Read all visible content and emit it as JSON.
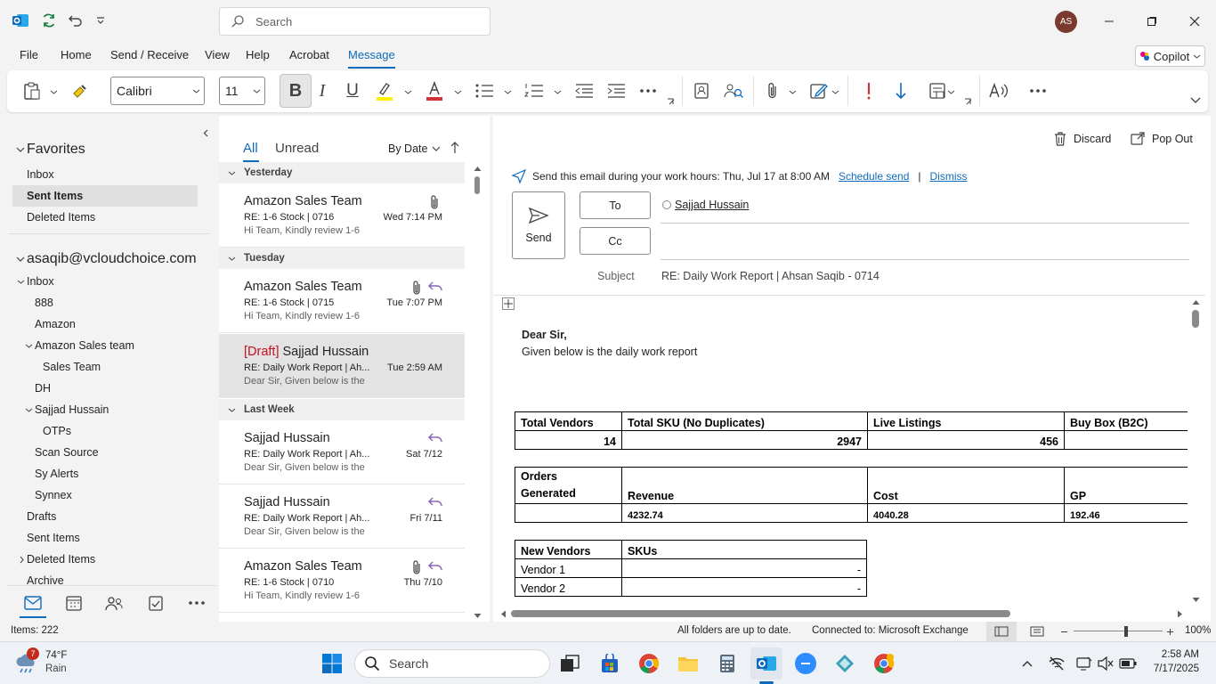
{
  "titlebar": {
    "search_placeholder": "Search",
    "avatar_initials": "AS"
  },
  "menu": [
    "File",
    "Home",
    "Send / Receive",
    "View",
    "Help",
    "Acrobat",
    "Message"
  ],
  "copilot_label": "Copilot",
  "ribbon": {
    "font_name": "Calibri",
    "font_size": "11",
    "bold": "B",
    "italic": "I",
    "underline": "U"
  },
  "nav": {
    "favorites": "Favorites",
    "fav_items": [
      "Inbox",
      "Sent Items",
      "Deleted Items"
    ],
    "account": "asaqib@vcloudchoice.com",
    "inbox": "Inbox",
    "folders": [
      "888",
      "Amazon",
      "Amazon Sales team",
      "Sales Team",
      "DH",
      "Sajjad Hussain",
      "OTPs",
      "Scan Source",
      "Sy Alerts",
      "Synnex",
      "Drafts",
      "Sent Items",
      "Deleted Items",
      "Archive"
    ]
  },
  "list": {
    "tab_all": "All",
    "tab_unread": "Unread",
    "sort": "By Date",
    "groups": [
      "Yesterday",
      "Tuesday",
      "Last Week"
    ],
    "items": [
      {
        "from": "Amazon Sales Team",
        "draft": "",
        "subject": "RE: 1-6 Stock | 0716",
        "preview": "Hi Team,  Kindly review 1-6",
        "time": "Wed 7:14 PM"
      },
      {
        "from": "Amazon Sales Team",
        "draft": "",
        "subject": "RE: 1-6 Stock | 0715",
        "preview": "Hi Team,  Kindly review 1-6",
        "time": "Tue 7:07 PM"
      },
      {
        "from": " Sajjad Hussain",
        "draft": "[Draft]",
        "subject": "RE: Daily Work Report | Ah...",
        "preview": "Dear Sir,  Given below is the",
        "time": "Tue 2:59 AM"
      },
      {
        "from": "Sajjad Hussain",
        "draft": "",
        "subject": "RE: Daily Work Report | Ah...",
        "preview": "Dear Sir,  Given below is the",
        "time": "Sat 7/12"
      },
      {
        "from": "Sajjad Hussain",
        "draft": "",
        "subject": "RE: Daily Work Report | Ah...",
        "preview": "Dear Sir,  Given below is the",
        "time": "Fri 7/11"
      },
      {
        "from": "Amazon Sales Team",
        "draft": "",
        "subject": "RE: 1-6 Stock | 0710",
        "preview": "Hi Team,  Kindly review 1-6",
        "time": "Thu 7/10"
      }
    ]
  },
  "reading": {
    "discard": "Discard",
    "popout": "Pop Out",
    "banner": "Send this email during your work hours: Thu, Jul 17 at 8:00 AM",
    "schedule": "Schedule send",
    "sep": "|",
    "dismiss": "Dismiss",
    "send": "Send",
    "to": "To",
    "cc": "Cc",
    "recipient": "Sajjad Hussain",
    "subject_label": "Subject",
    "subject": "RE: Daily Work Report | Ahsan Saqib - 0714",
    "greeting": "Dear Sir,",
    "intro": "Given below is the daily work report",
    "t1": {
      "h": [
        "Total Vendors",
        "Total SKU (No Duplicates)",
        "Live Listings",
        "Buy Box (B2C)"
      ],
      "v": [
        "14",
        "2947",
        "456",
        ""
      ]
    },
    "t2": {
      "h1": "Orders",
      "h2": "Generated",
      "h": [
        "Revenue",
        "Cost",
        "GP"
      ],
      "v": [
        "",
        "4232.74",
        "4040.28",
        "192.46"
      ]
    },
    "t3": {
      "h": [
        "New Vendors",
        "SKUs"
      ],
      "rows": [
        [
          "Vendor 1",
          "-"
        ],
        [
          "Vendor 2",
          "-"
        ]
      ]
    }
  },
  "status": {
    "items": "Items: 222",
    "sync": "All folders are up to date.",
    "conn": "Connected to: Microsoft Exchange",
    "zoom": "100%",
    "zoom_level": 100
  },
  "taskbar": {
    "temp": "74°F",
    "weather": "Rain",
    "badge": "7",
    "search": "Search",
    "time": "2:58 AM",
    "date": "7/17/2025"
  }
}
